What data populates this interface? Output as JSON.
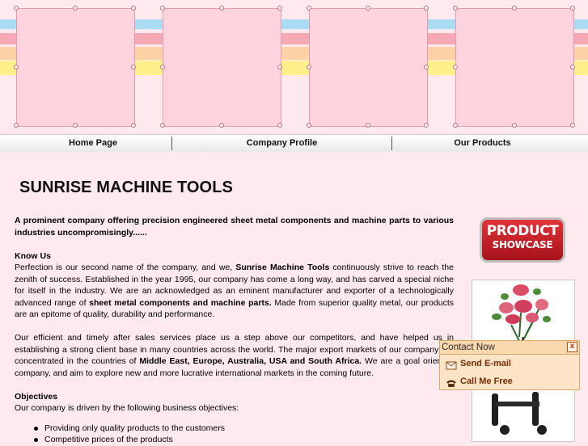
{
  "nav": {
    "items": [
      {
        "label": "Home Page"
      },
      {
        "label": "Company Profile"
      },
      {
        "label": "Our Products"
      }
    ]
  },
  "page": {
    "title": "SUNRISE MACHINE TOOLS",
    "intro": "A prominent company offering precision engineered sheet metal components and machine parts to various industries uncompromisingly......",
    "know_us": {
      "heading": "Know Us",
      "p1_part1": "Perfection is our second name of the company, and we, ",
      "p1_company": "Sunrise Machine Tools",
      "p1_part2": " continuously strive to reach the zenith of success. Established in the year 1995, our company has come a long way, and has carved a special niche for itself in the industry. We are an acknowledged as an eminent manufacturer and exporter of a technologically advanced range of ",
      "p1_products": "sheet metal components and machine parts.",
      "p1_part3": " Made from superior quality metal, our products are an epitome of quality, durability and performance.",
      "p2_part1": "Our efficient and timely after sales services place us a step above our competitors, and have helped us in establishing a strong client base in many countries across the world. The major export markets of our company are concentrated in the countries of ",
      "p2_markets": "Middle East, Europe, Australia, USA and South Africa.",
      "p2_part2": " We are a goal oriented company, and aim to explore new and more lucrative international markets in the coming future."
    },
    "objectives": {
      "heading": "Objectives",
      "intro": "Our company is driven by the following business objectives:",
      "items": [
        "Providing only quality products to the customers",
        "Competitive prices of the products"
      ]
    }
  },
  "showcase": {
    "line1": "PRODUCT",
    "line2": "SHOWCASE"
  },
  "contact": {
    "title": "Contact Now",
    "close": "x",
    "email_label": "Send E-mail",
    "call_label": "Call Me Free"
  },
  "colors": {
    "background": "#fde9ee",
    "panel": "#ffd4df",
    "showcase_red": "#c8232b",
    "contact_bg": "#fde4c7",
    "contact_text": "#7a2a08"
  }
}
